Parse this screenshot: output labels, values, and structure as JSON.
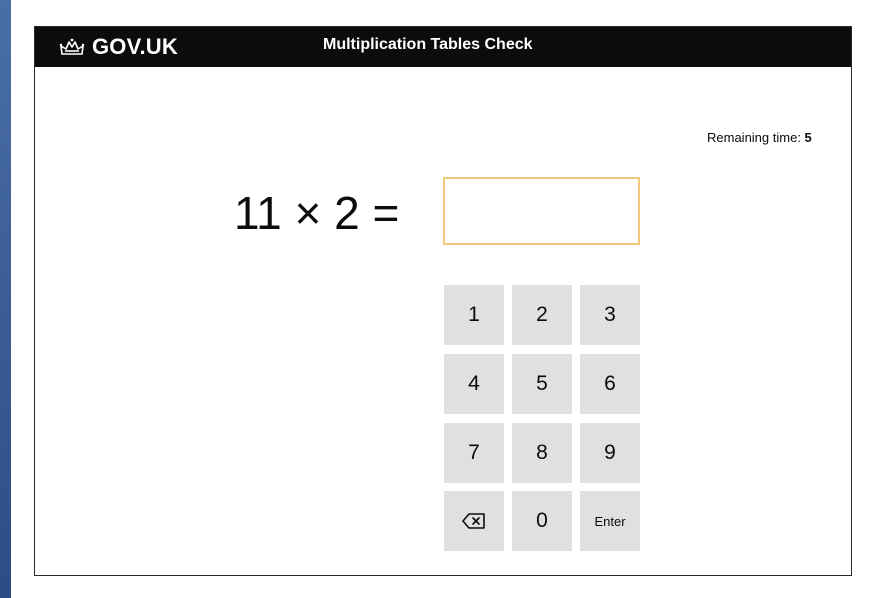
{
  "header": {
    "brand": "GOV.UK",
    "title": "Multiplication Tables Check",
    "crown_icon": "crown-icon",
    "background": "#0b0c0c"
  },
  "timer": {
    "label": "Remaining time: ",
    "value": "5"
  },
  "question": {
    "text": "11 × 2 ="
  },
  "answer_input": {
    "value": "",
    "border_color": "#f5c97a"
  },
  "keypad": {
    "key_background": "#dee0e2",
    "keys": {
      "k1": "1",
      "k2": "2",
      "k3": "3",
      "k4": "4",
      "k5": "5",
      "k6": "6",
      "k7": "7",
      "k8": "8",
      "k9": "9",
      "k0": "0",
      "enter": "Enter",
      "backspace_icon": "backspace-icon"
    }
  }
}
